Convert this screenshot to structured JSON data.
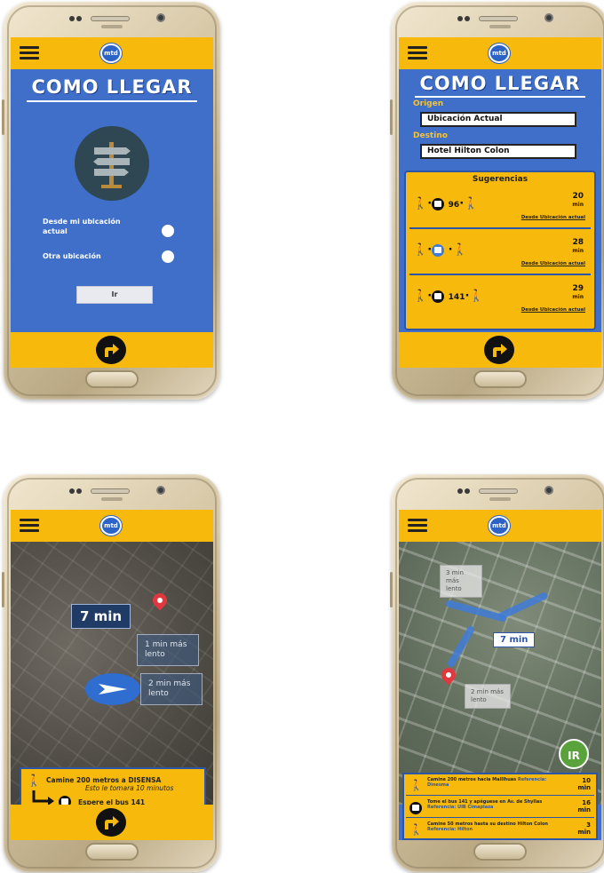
{
  "app": {
    "logo_text": "mtd",
    "title": "COMO LLEGAR"
  },
  "screen1": {
    "option1_label": "Desde mi ubicación actual",
    "option2_label": "Otra ubicación",
    "go_label": "Ir"
  },
  "screen2": {
    "origin_label": "Origen",
    "origin_value": "Ubicación Actual",
    "destination_label": "Destino",
    "destination_value": "Hotel Hilton Colon",
    "suggestions_title": "Sugerencias",
    "routes": [
      {
        "bus_number": "96",
        "minutes": "20",
        "unit": "min",
        "from": "Desde Ubicación actual"
      },
      {
        "bus_number": "",
        "minutes": "28",
        "unit": "min",
        "from": "Desde Ubicación actual"
      },
      {
        "bus_number": "141",
        "minutes": "29",
        "unit": "min",
        "from": "Desde Ubicación actual"
      }
    ]
  },
  "screen3": {
    "time_badge": "7 min",
    "alt1": "1 min más lento",
    "alt2": "2 min más lento",
    "step1_text": "Camine 200 metros a DISENSA",
    "step1_sub": "Esto le tomara 10 minutos",
    "step2_text": "Espere el bus 141"
  },
  "screen4": {
    "alt1": "3 min más lento",
    "time_badge": "7 min",
    "alt2": "2 min más lento",
    "ir_label": "IR",
    "instructions": [
      {
        "text": "Camine 200 metros hacia Malllhuas",
        "ref": "Referencia: Dinesma",
        "minutes": "10",
        "unit": "min"
      },
      {
        "text": "Tome el bus 141 y apéguese en Av. de Shyllas",
        "ref": "Referencia: UIB Cimaplaza",
        "minutes": "16",
        "unit": "min"
      },
      {
        "text": "Camine 50 metros hasta su destino Hilton Colon",
        "ref": "Referencia: Hilton",
        "minutes": "3",
        "unit": "min"
      }
    ]
  },
  "colors": {
    "brand_yellow": "#f8b90d",
    "brand_blue": "#3f6fc8",
    "map_route": "#3f7bd8",
    "go_green": "#5aa23c"
  }
}
